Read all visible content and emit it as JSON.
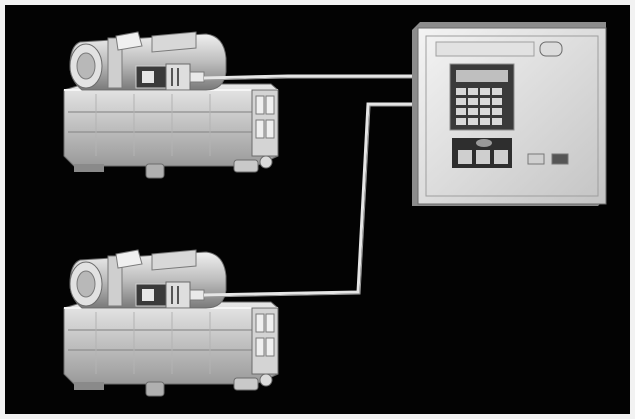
{
  "diagram": {
    "machines": [
      {
        "id": "machine-1",
        "depicts": "compressor-unit"
      },
      {
        "id": "machine-2",
        "depicts": "compressor-unit"
      }
    ],
    "controller": {
      "depicts": "control-panel"
    },
    "connections": [
      {
        "from": "machine-1",
        "to": "controller"
      },
      {
        "from": "machine-2",
        "to": "controller"
      }
    ],
    "colors": {
      "background": "#030303",
      "frame": "#f2f2f2",
      "equipment_light": "#d9d9d9",
      "equipment_mid": "#a9a9a9",
      "equipment_dark": "#5a5a5a",
      "cable": "#e6e6e6"
    }
  }
}
